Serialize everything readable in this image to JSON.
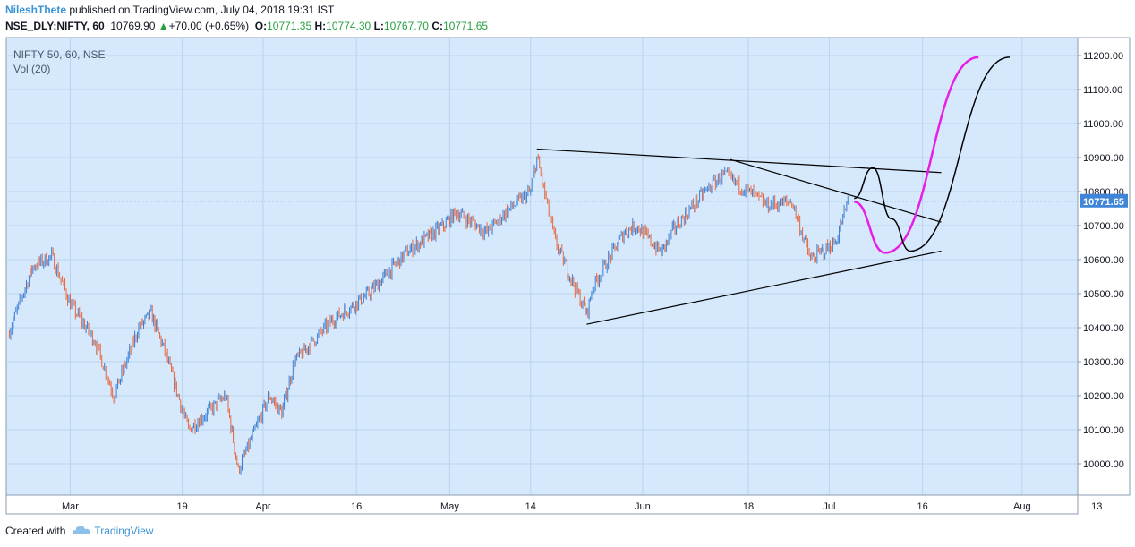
{
  "header": {
    "author": "NileshThete",
    "published_text": "published on TradingView.com, July 04, 2018 19:31 IST",
    "symbol": "NSE_DLY:NIFTY, 60",
    "last": "10769.90",
    "change": "+70.00 (+0.65%)",
    "o_label": "O:",
    "o_value": "10771.35",
    "h_label": "H:",
    "h_value": "10774.30",
    "l_label": "L:",
    "l_value": "10767.70",
    "c_label": "C:",
    "c_value": "10771.65"
  },
  "legend": {
    "title": "NIFTY 50, 60, NSE",
    "indicator": "Vol (20)"
  },
  "price_tag": "10771.65",
  "footer": {
    "created_with": "Created with",
    "brand": "TradingView"
  },
  "colors": {
    "background": "#d6e8fb",
    "grid": "#b9d3ee",
    "up": "#3a7fd5",
    "down": "#e8653a",
    "projection_magenta": "#e61ee6",
    "projection_black": "#000000",
    "price_tag": "#3f86d9",
    "brand": "#3a93d6"
  },
  "chart_data": {
    "type": "candlestick",
    "title": "NIFTY 50, 60, NSE",
    "interval": "60",
    "y_axis": {
      "ticks": [
        "10000.00",
        "10100.00",
        "10200.00",
        "10300.00",
        "10400.00",
        "10500.00",
        "10600.00",
        "10700.00",
        "10800.00",
        "10900.00",
        "11000.00",
        "11100.00",
        "11200.00"
      ],
      "range": [
        9920,
        11240
      ]
    },
    "x_axis": {
      "ticks": [
        "Mar",
        "19",
        "Apr",
        "16",
        "May",
        "14",
        "Jun",
        "18",
        "Jul",
        "16",
        "Aug",
        "13"
      ]
    },
    "current_price": 10771.65,
    "close_path": [
      {
        "date": "2018-02-19",
        "price": 10380
      },
      {
        "date": "2018-02-23",
        "price": 10580
      },
      {
        "date": "2018-02-26",
        "price": 10610
      },
      {
        "date": "2018-03-01",
        "price": 10470
      },
      {
        "date": "2018-03-05",
        "price": 10360
      },
      {
        "date": "2018-03-08",
        "price": 10200
      },
      {
        "date": "2018-03-12",
        "price": 10400
      },
      {
        "date": "2018-03-14",
        "price": 10440
      },
      {
        "date": "2018-03-16",
        "price": 10340
      },
      {
        "date": "2018-03-20",
        "price": 10100
      },
      {
        "date": "2018-03-23",
        "price": 10150
      },
      {
        "date": "2018-03-26",
        "price": 10200
      },
      {
        "date": "2018-03-28",
        "price": 9980
      },
      {
        "date": "2018-04-02",
        "price": 10200
      },
      {
        "date": "2018-04-04",
        "price": 10150
      },
      {
        "date": "2018-04-06",
        "price": 10300
      },
      {
        "date": "2018-04-12",
        "price": 10420
      },
      {
        "date": "2018-04-18",
        "price": 10500
      },
      {
        "date": "2018-04-24",
        "price": 10620
      },
      {
        "date": "2018-04-30",
        "price": 10700
      },
      {
        "date": "2018-05-02",
        "price": 10740
      },
      {
        "date": "2018-05-07",
        "price": 10680
      },
      {
        "date": "2018-05-10",
        "price": 10740
      },
      {
        "date": "2018-05-14",
        "price": 10800
      },
      {
        "date": "2018-05-15",
        "price": 10900
      },
      {
        "date": "2018-05-18",
        "price": 10650
      },
      {
        "date": "2018-05-23",
        "price": 10440
      },
      {
        "date": "2018-05-24",
        "price": 10520
      },
      {
        "date": "2018-05-29",
        "price": 10680
      },
      {
        "date": "2018-05-31",
        "price": 10700
      },
      {
        "date": "2018-06-04",
        "price": 10620
      },
      {
        "date": "2018-06-06",
        "price": 10690
      },
      {
        "date": "2018-06-11",
        "price": 10800
      },
      {
        "date": "2018-06-14",
        "price": 10850
      },
      {
        "date": "2018-06-18",
        "price": 10800
      },
      {
        "date": "2018-06-21",
        "price": 10760
      },
      {
        "date": "2018-06-25",
        "price": 10770
      },
      {
        "date": "2018-06-28",
        "price": 10600
      },
      {
        "date": "2018-07-02",
        "price": 10650
      },
      {
        "date": "2018-07-04",
        "price": 10771.65
      }
    ],
    "drawings": [
      {
        "name": "upper-trendline",
        "type": "line",
        "points": [
          {
            "date": "2018-05-15",
            "price": 10925
          },
          {
            "date": "2018-07-19",
            "price": 10856
          }
        ]
      },
      {
        "name": "descending-trendline",
        "type": "line",
        "points": [
          {
            "date": "2018-06-15",
            "price": 10895
          },
          {
            "date": "2018-07-19",
            "price": 10710
          }
        ]
      },
      {
        "name": "lower-trendline",
        "type": "line",
        "points": [
          {
            "date": "2018-05-23",
            "price": 10410
          },
          {
            "date": "2018-07-19",
            "price": 10625
          }
        ]
      },
      {
        "name": "projection-magenta",
        "type": "curve",
        "points": [
          {
            "date": "2018-07-05",
            "price": 10770
          },
          {
            "date": "2018-07-10",
            "price": 10620
          },
          {
            "date": "2018-07-25",
            "price": 11195
          }
        ]
      },
      {
        "name": "projection-black",
        "type": "curve",
        "points": [
          {
            "date": "2018-07-05",
            "price": 10780
          },
          {
            "date": "2018-07-08",
            "price": 10870
          },
          {
            "date": "2018-07-11",
            "price": 10720
          },
          {
            "date": "2018-07-14",
            "price": 10625
          },
          {
            "date": "2018-07-30",
            "price": 11195
          }
        ]
      }
    ]
  }
}
